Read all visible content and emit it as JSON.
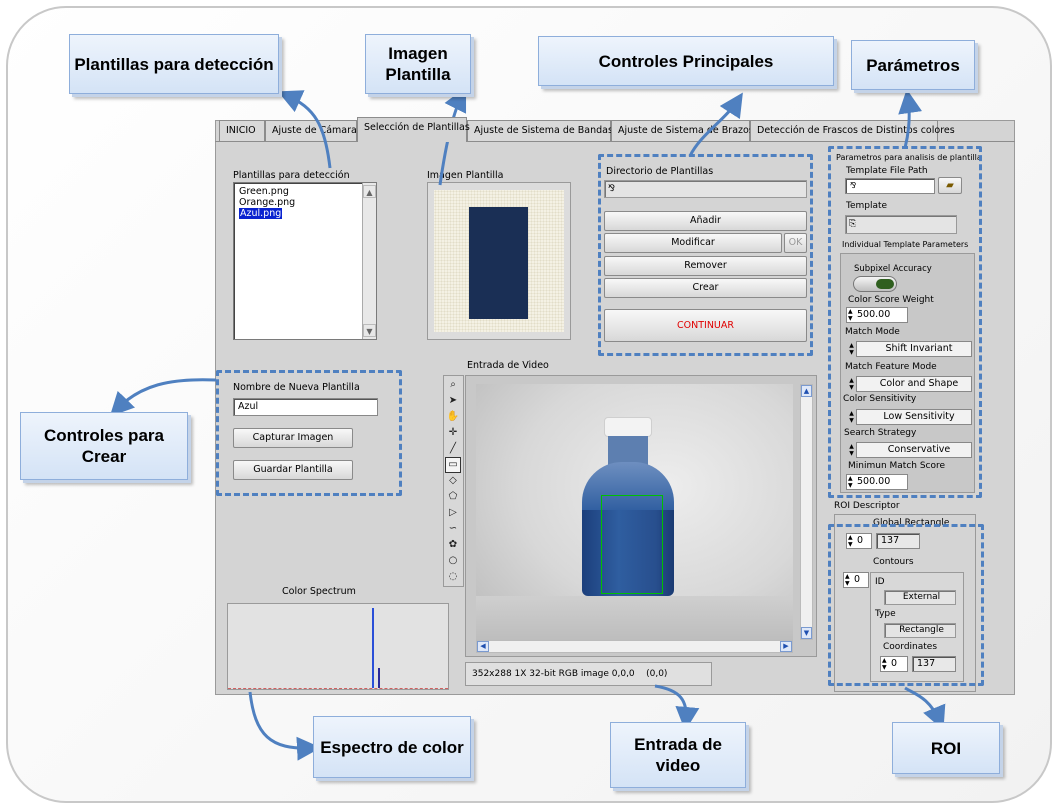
{
  "tabs": [
    {
      "label": "INICIO"
    },
    {
      "label": "Ajuste de Cámara"
    },
    {
      "label": "Selección de Plantillas"
    },
    {
      "label": "Ajuste de Sistema de Bandas"
    },
    {
      "label": "Ajuste de Sistema de Brazos"
    },
    {
      "label": "Detección de Frascos de Distintos colores"
    }
  ],
  "active_tab": "Selección de Plantillas",
  "templates": {
    "label": "Plantillas para detección",
    "items": [
      "Green.png",
      "Orange.png",
      "Azul.png"
    ],
    "selected": "Azul.png"
  },
  "template_image": {
    "label": "Imagen Plantilla",
    "swatch_color": "#1a2f55"
  },
  "main_controls": {
    "dir_label": "Directorio de Plantillas",
    "add": "Añadir",
    "modify": "Modificar",
    "ok": "OK",
    "remove": "Remover",
    "create": "Crear",
    "continue": "CONTINUAR"
  },
  "create_controls": {
    "name_label": "Nombre de Nueva Plantilla",
    "name_value": "Azul",
    "capture": "Capturar Imagen",
    "save": "Guardar Plantilla"
  },
  "video": {
    "label": "Entrada de Video",
    "status": "352x288 1X 32-bit RGB image 0,0,0    (0,0)"
  },
  "spectrum": {
    "label": "Color Spectrum"
  },
  "params": {
    "title": "Parametros para analisis de plantilla",
    "file_path_label": "Template File Path",
    "template_label": "Template",
    "individual_label": "Individual Template Parameters",
    "subpixel_label": "Subpixel Accuracy",
    "color_score_label": "Color Score Weight",
    "color_score_value": "500.00",
    "match_mode_label": "Match Mode",
    "match_mode_value": "Shift Invariant",
    "match_feature_label": "Match Feature Mode",
    "match_feature_value": "Color and Shape",
    "color_sens_label": "Color Sensitivity",
    "color_sens_value": "Low Sensitivity",
    "search_label": "Search Strategy",
    "search_value": "Conservative",
    "min_score_label": "Minimun Match Score",
    "min_score_value": "500.00"
  },
  "roi": {
    "title": "ROI Descriptor",
    "global_label": "Global Rectangle",
    "index_value": "0",
    "global_value": "137",
    "contours_label": "Contours",
    "contour_index": "0",
    "id_label": "ID",
    "id_value": "External",
    "type_label": "Type",
    "type_value": "Rectangle",
    "coords_label": "Coordinates",
    "coords_index": "0",
    "coords_value": "137"
  },
  "callouts": {
    "plantillas": "Plantillas para detección",
    "imagen": "Imagen Plantilla",
    "controles_principales": "Controles Principales",
    "parametros": "Parámetros",
    "controles_crear": "Controles para Crear",
    "espectro": "Espectro de color",
    "entrada": "Entrada de video",
    "roi": "ROI"
  },
  "colors": {
    "annotation_blue": "#4f80c0",
    "selection_blue": "#0a23d0",
    "continue_red": "#e00000",
    "bottle_liquid": "#264f8c",
    "roi_green": "#00c000"
  }
}
